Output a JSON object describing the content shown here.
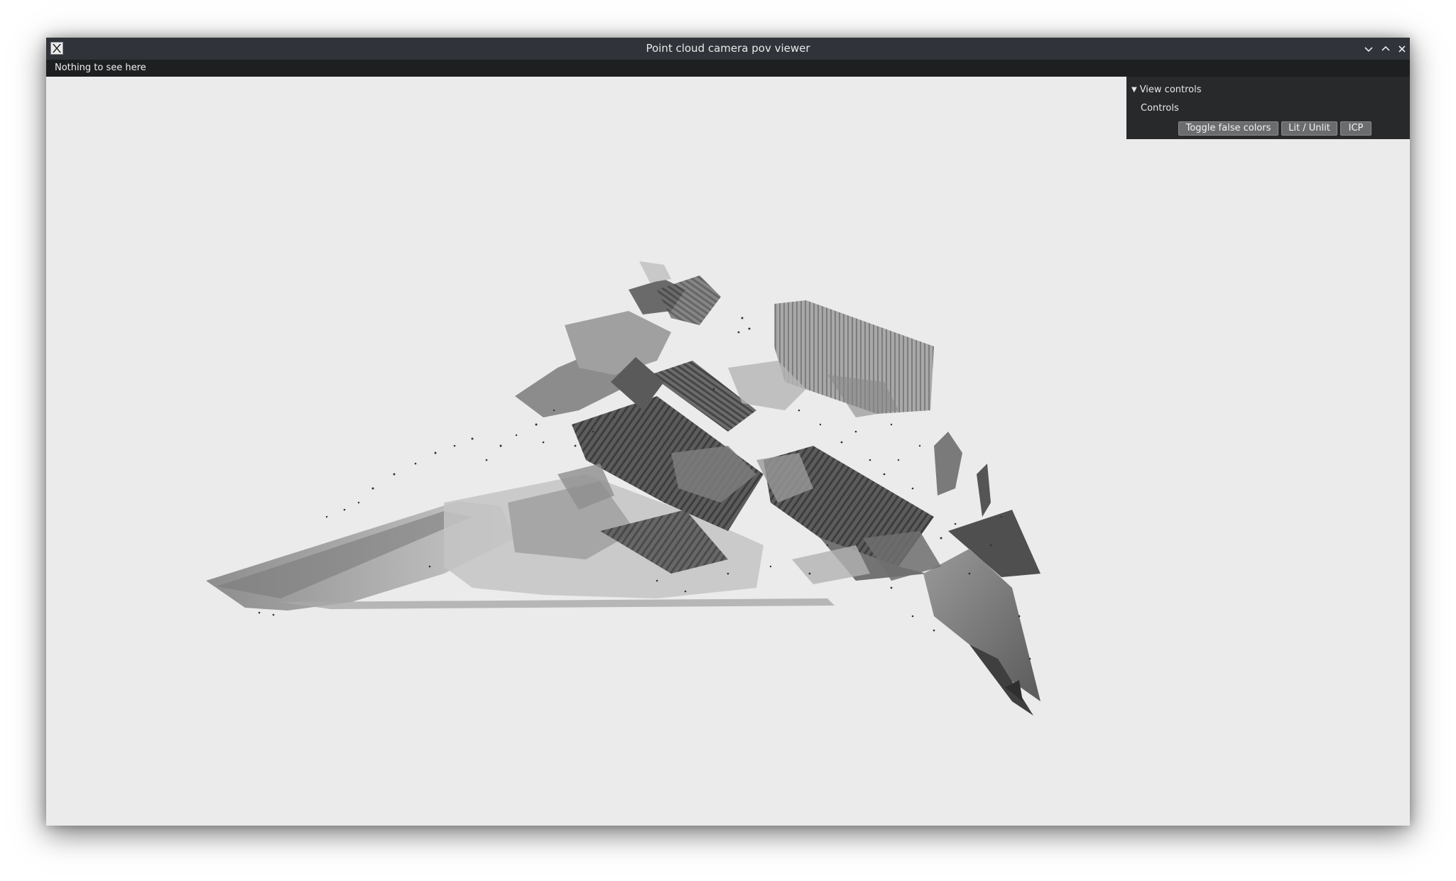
{
  "window": {
    "title": "Point cloud camera pov viewer",
    "icon": "x-window-icon",
    "controls": [
      "minimize-icon",
      "maximize-icon",
      "close-icon"
    ]
  },
  "menubar": {
    "label": "Nothing to see here"
  },
  "panel": {
    "header": "View controls",
    "section": "Controls",
    "buttons": {
      "toggle_false_colors": "Toggle false colors",
      "lit_unlit": "Lit / Unlit",
      "icp": "ICP"
    }
  },
  "viewport": {
    "content": "grayscale-point-cloud",
    "background": "#ebebeb"
  },
  "colors": {
    "titlebar": "#30343a",
    "menubar": "#1d1f21",
    "panel": "#27292b",
    "button": "#6a6c6e"
  }
}
